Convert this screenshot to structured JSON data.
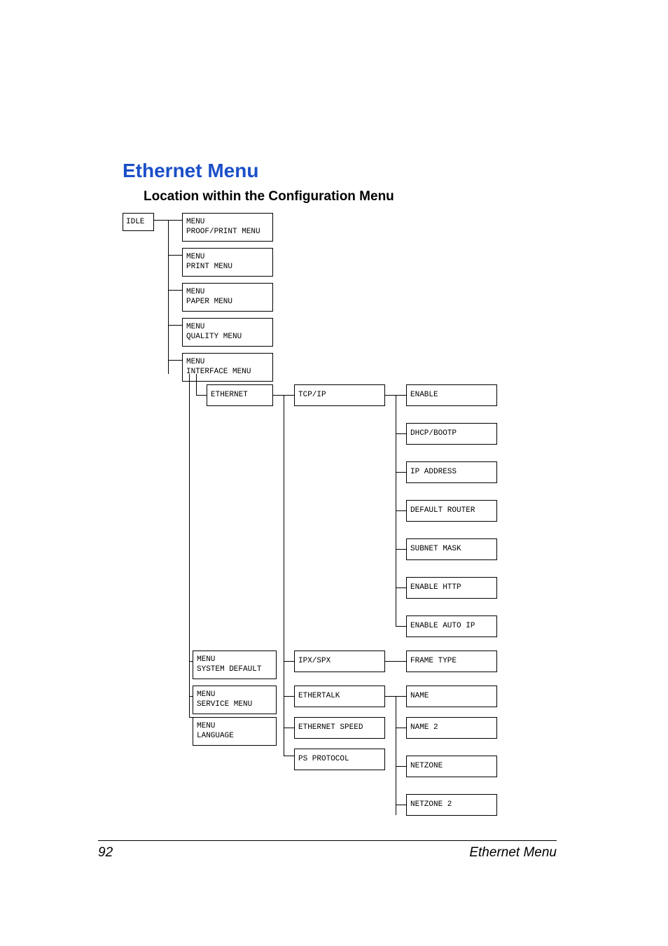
{
  "title": "Ethernet Menu",
  "subtitle": "Location within the Configuration Menu",
  "idle": "IDLE",
  "menu_prefix": "MENU",
  "menus": {
    "proof_print": "PROOF/PRINT MENU",
    "print": "PRINT MENU",
    "paper": "PAPER MENU",
    "quality": "QUALITY MENU",
    "interface": "INTERFACE MENU",
    "system_default": "SYSTEM DEFAULT",
    "service": "SERVICE MENU",
    "language": "LANGUAGE"
  },
  "ethernet": "ETHERNET",
  "col2": {
    "tcpip": "TCP/IP",
    "ipxspx": "IPX/SPX",
    "ethertalk": "ETHERTALK",
    "ethernet_speed": "ETHERNET SPEED",
    "ps_protocol": "PS PROTOCOL"
  },
  "col3": {
    "enable": "ENABLE",
    "dhcp": "DHCP/BOOTP",
    "ip": "IP ADDRESS",
    "router": "DEFAULT ROUTER",
    "subnet": "SUBNET MASK",
    "http": "ENABLE HTTP",
    "autoip": "ENABLE AUTO IP",
    "frame": "FRAME TYPE",
    "name": "NAME",
    "name2": "NAME 2",
    "netzone": "NETZONE",
    "netzone2": "NETZONE 2"
  },
  "footer": {
    "page": "92",
    "label": "Ethernet Menu"
  }
}
